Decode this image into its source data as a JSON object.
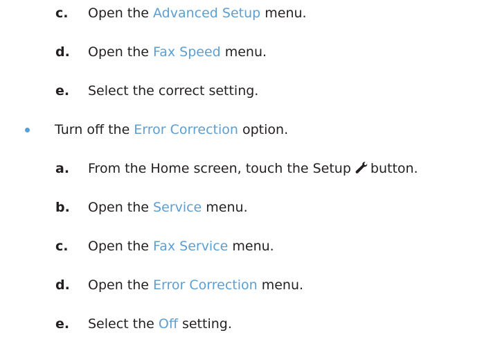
{
  "steps_top": [
    {
      "letter": "c.",
      "pre": "Open the ",
      "link": "Advanced Setup",
      "post": " menu."
    },
    {
      "letter": "d.",
      "pre": "Open the ",
      "link": "Fax Speed",
      "post": " menu."
    },
    {
      "letter": "e.",
      "text": "Select the correct setting."
    }
  ],
  "bullet": {
    "pre": "Turn off the ",
    "link": "Error Correction",
    "post": " option."
  },
  "steps_bottom": [
    {
      "letter": "a.",
      "pre": "From the Home screen, touch the Setup",
      "post": "button.",
      "icon": "wrench-icon"
    },
    {
      "letter": "b.",
      "pre": "Open the ",
      "link": "Service",
      "post": " menu."
    },
    {
      "letter": "c.",
      "pre": "Open the ",
      "link": "Fax Service",
      "post": " menu."
    },
    {
      "letter": "d.",
      "pre": "Open the ",
      "link": "Error Correction",
      "post": " menu."
    },
    {
      "letter": "e.",
      "pre": "Select the ",
      "link": "Off",
      "post": " setting."
    }
  ],
  "colors": {
    "link": "#5a9fd4",
    "text": "#231f20"
  }
}
